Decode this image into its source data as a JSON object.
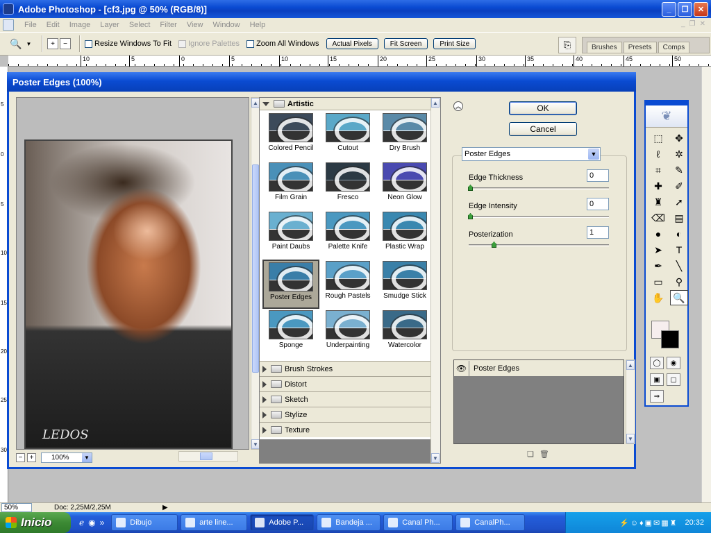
{
  "window": {
    "title": "Adobe Photoshop - [cf3.jpg @ 50% (RGB/8)]"
  },
  "menu": [
    "File",
    "Edit",
    "Image",
    "Layer",
    "Select",
    "Filter",
    "View",
    "Window",
    "Help"
  ],
  "options": {
    "checkboxes": [
      {
        "label": "Resize Windows To Fit",
        "checked": false,
        "enabled": true
      },
      {
        "label": "Ignore Palettes",
        "checked": false,
        "enabled": false
      },
      {
        "label": "Zoom All Windows",
        "checked": false,
        "enabled": true
      }
    ],
    "buttons": [
      "Actual Pixels",
      "Fit Screen",
      "Print Size"
    ],
    "palette_tabs": [
      "Brushes",
      "Presets",
      "Comps"
    ]
  },
  "ruler": {
    "top": [
      "10",
      "5",
      "0",
      "5",
      "10",
      "15",
      "20",
      "25",
      "30",
      "35",
      "40",
      "45",
      "50"
    ],
    "left": [
      "5",
      "0",
      "5",
      "10",
      "15",
      "20",
      "25",
      "30"
    ]
  },
  "dialog": {
    "title": "Poster Edges (100%)",
    "zoom": "100%",
    "ok_label": "OK",
    "cancel_label": "Cancel",
    "open_category": "Artistic",
    "thumbnails": [
      {
        "label": "Colored Pencil",
        "bg": "#3c4a5a",
        "fg": "#dcdcdc"
      },
      {
        "label": "Cutout",
        "bg": "#5aa8c8",
        "fg": "#e8e8e8"
      },
      {
        "label": "Dry Brush",
        "bg": "#5a8aa8",
        "fg": "#ffffff"
      },
      {
        "label": "Film Grain",
        "bg": "#4a90b8",
        "fg": "#e8e8e8"
      },
      {
        "label": "Fresco",
        "bg": "#2c3a44",
        "fg": "#8a9aa8"
      },
      {
        "label": "Neon Glow",
        "bg": "#4a4ab0",
        "fg": "#ffffff"
      },
      {
        "label": "Paint Daubs",
        "bg": "#6ab0d0",
        "fg": "#f0f0f0"
      },
      {
        "label": "Palette Knife",
        "bg": "#4a98c0",
        "fg": "#ffffff"
      },
      {
        "label": "Plastic Wrap",
        "bg": "#3a88b0",
        "fg": "#e0e0e0"
      },
      {
        "label": "Poster Edges",
        "bg": "#3a7ea8",
        "fg": "#f0f0f0"
      },
      {
        "label": "Rough Pastels",
        "bg": "#5aa0c8",
        "fg": "#e8e8e8"
      },
      {
        "label": "Smudge Stick",
        "bg": "#3a80a8",
        "fg": "#d8d8d8"
      },
      {
        "label": "Sponge",
        "bg": "#4a98c0",
        "fg": "#ececec"
      },
      {
        "label": "Underpainting",
        "bg": "#7ab0d0",
        "fg": "#ffffff"
      },
      {
        "label": "Watercolor",
        "bg": "#3a6a88",
        "fg": "#c8c8c8"
      }
    ],
    "selected_thumbnail": "Poster Edges",
    "categories": [
      "Brush Strokes",
      "Distort",
      "Sketch",
      "Stylize",
      "Texture"
    ],
    "filter_select": "Poster Edges",
    "params": [
      {
        "label": "Edge Thickness",
        "value": "0",
        "fraction": 0.0
      },
      {
        "label": "Edge Intensity",
        "value": "0",
        "fraction": 0.0
      },
      {
        "label": "Posterization",
        "value": "1",
        "fraction": 0.17
      }
    ],
    "layer_name": "Poster Edges",
    "preview_signature": "LEDOS"
  },
  "status": {
    "zoom": "50%",
    "doc": "Doc: 2,25M/2,25M"
  },
  "taskbar": {
    "start_label": "Inicio",
    "tasks": [
      {
        "label": "Dibujo",
        "active": false
      },
      {
        "label": "arte line...",
        "active": false
      },
      {
        "label": "Adobe P...",
        "active": true
      },
      {
        "label": "Bandeja ...",
        "active": false
      },
      {
        "label": "Canal Ph...",
        "active": false
      },
      {
        "label": "CanalPh...",
        "active": false
      }
    ],
    "time": "20:32"
  }
}
